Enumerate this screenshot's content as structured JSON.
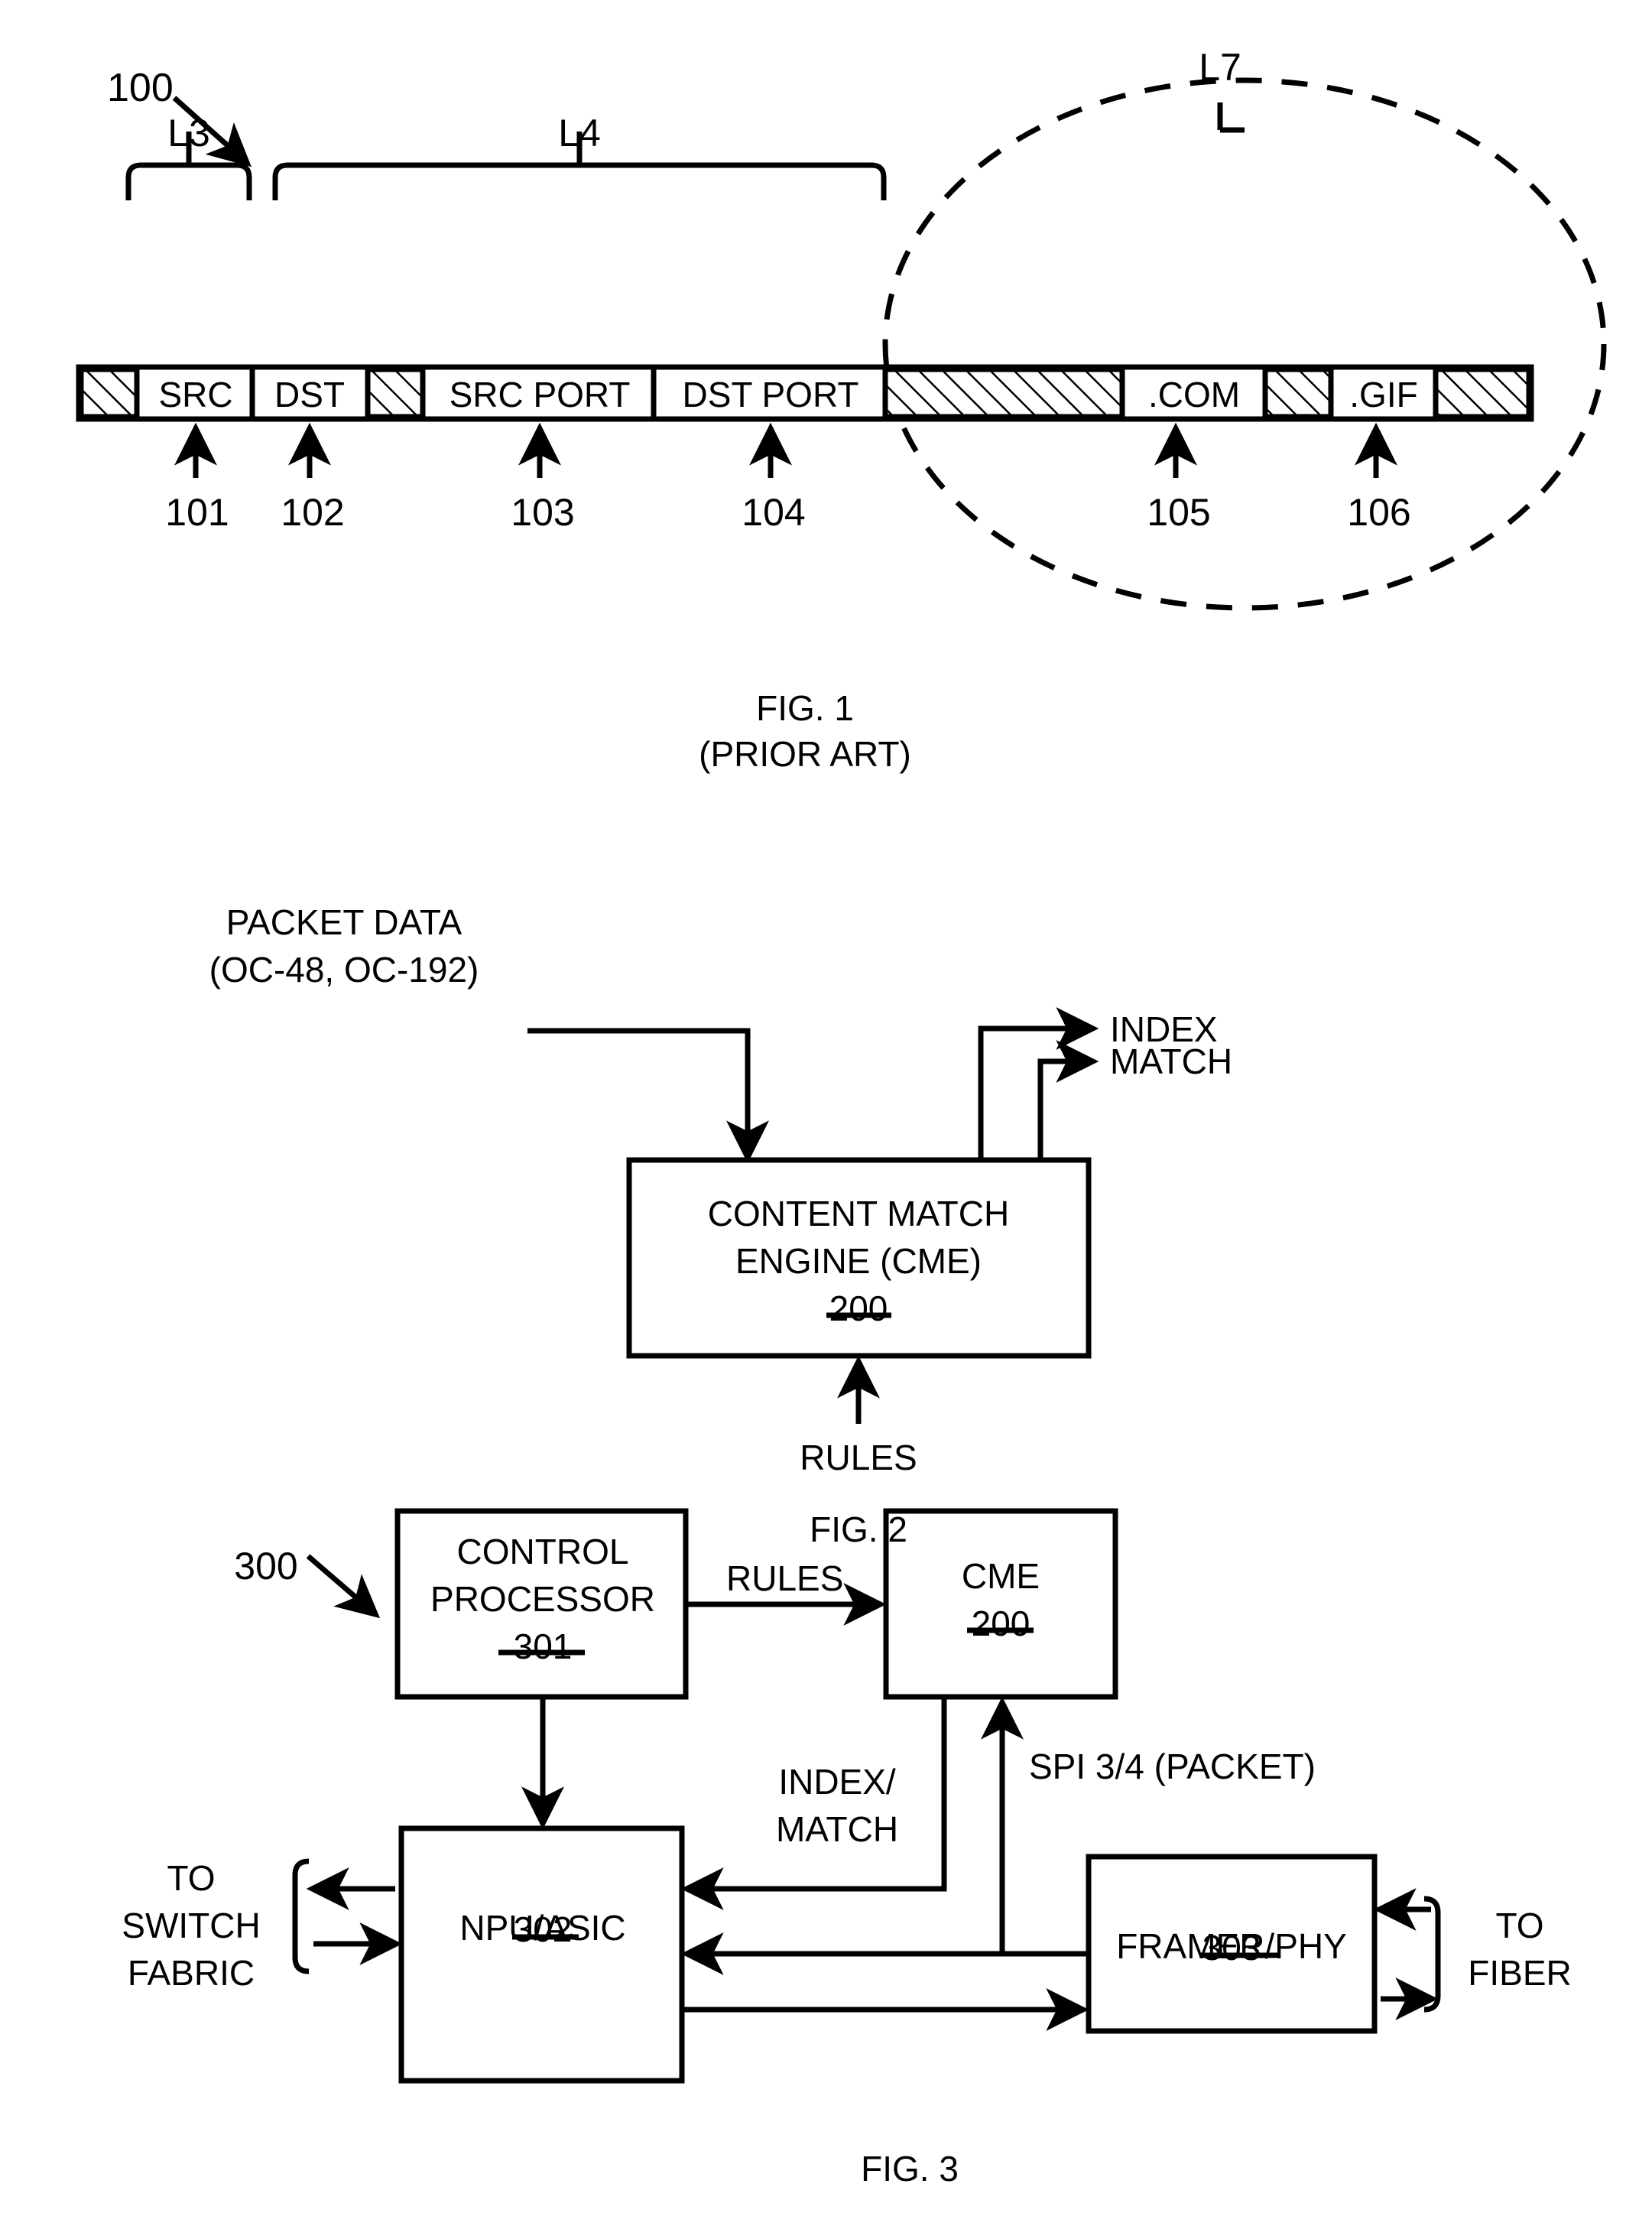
{
  "document": {
    "type": "patent-drawing-sheet",
    "figures": [
      "FIG. 1",
      "FIG. 2",
      "FIG. 3"
    ]
  },
  "fig1": {
    "caption_line1": "FIG. 1",
    "caption_line2": "(PRIOR ART)",
    "ref_main": "100",
    "layer_labels": {
      "l3": "L3",
      "l4": "L4",
      "l7": "L7"
    },
    "packet_segments": [
      {
        "label": "",
        "kind": "hatched"
      },
      {
        "label": "SRC",
        "kind": "plain"
      },
      {
        "label": "DST",
        "kind": "plain"
      },
      {
        "label": "",
        "kind": "hatched"
      },
      {
        "label": "SRC PORT",
        "kind": "plain"
      },
      {
        "label": "DST PORT",
        "kind": "plain"
      },
      {
        "label": "",
        "kind": "hatched"
      },
      {
        "label": ".COM",
        "kind": "plain"
      },
      {
        "label": "",
        "kind": "hatched"
      },
      {
        "label": ".GIF",
        "kind": "plain"
      },
      {
        "label": "",
        "kind": "hatched"
      }
    ],
    "callouts": [
      {
        "num": "101",
        "target": "SRC"
      },
      {
        "num": "102",
        "target": "DST"
      },
      {
        "num": "103",
        "target": "SRC PORT"
      },
      {
        "num": "104",
        "target": "DST PORT"
      },
      {
        "num": "105",
        "target": ".COM"
      },
      {
        "num": "106",
        "target": ".GIF"
      }
    ]
  },
  "fig2": {
    "caption": "FIG. 2",
    "input_label_line1": "PACKET DATA",
    "input_label_line2": "(OC-48, OC-192)",
    "output_index": "INDEX",
    "output_match": "MATCH",
    "input_rules": "RULES",
    "block": {
      "line1": "CONTENT MATCH",
      "line2": "ENGINE (CME)",
      "ref": "200"
    }
  },
  "fig3": {
    "caption": "FIG. 3",
    "ref_main": "300",
    "blocks": [
      {
        "id": "control-processor",
        "line1": "CONTROL",
        "line2": "PROCESSOR",
        "ref": "301"
      },
      {
        "id": "cme",
        "line1": "CME",
        "line2": "",
        "ref": "200"
      },
      {
        "id": "npu-asic",
        "line1": "NPU/ASIC",
        "line2": "",
        "ref": "302"
      },
      {
        "id": "framer-phy",
        "line1": "FRAMER/PHY",
        "line2": "",
        "ref": "303"
      }
    ],
    "edge_labels": {
      "rules": "RULES",
      "index_match_line1": "INDEX/",
      "index_match_line2": "MATCH",
      "spi": "SPI 3/4 (PACKET)"
    },
    "side_labels": {
      "switch_fabric_line1": "TO",
      "switch_fabric_line2": "SWITCH",
      "switch_fabric_line3": "FABRIC",
      "fiber_line1": "TO",
      "fiber_line2": "FIBER"
    }
  },
  "colors": {
    "ink": "#000000",
    "paper": "#ffffff"
  }
}
